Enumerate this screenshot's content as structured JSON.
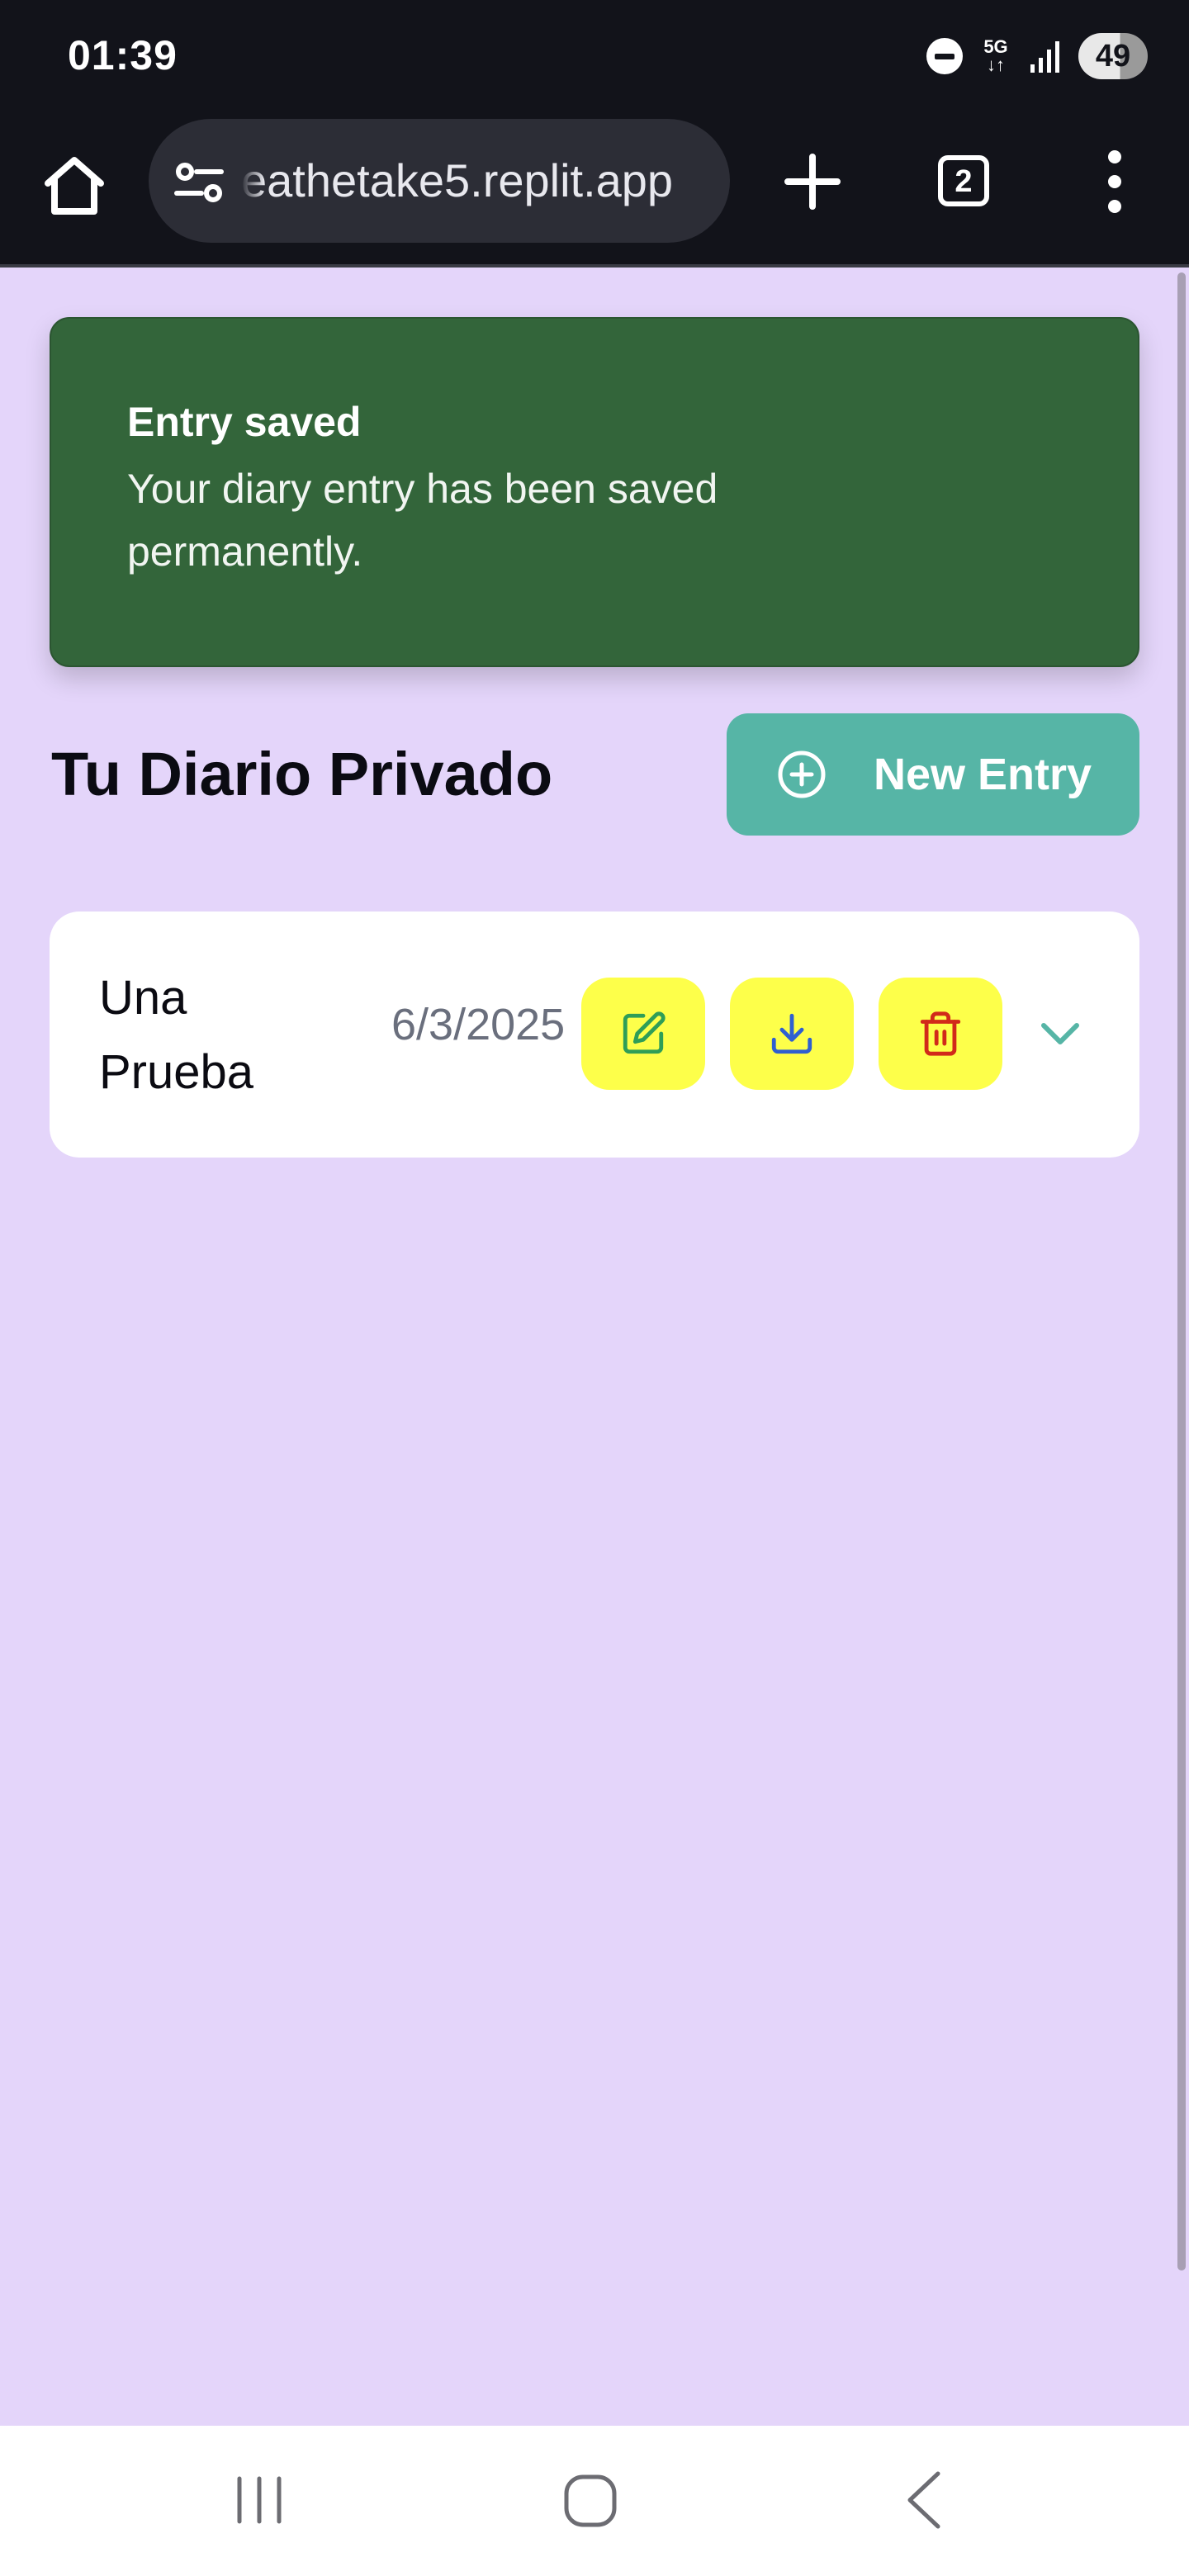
{
  "status_bar": {
    "time": "01:39",
    "network": "5G",
    "battery": "49",
    "icons": [
      "do-not-disturb-icon",
      "network-5g-icon",
      "signal-icon",
      "battery-icon"
    ]
  },
  "browser": {
    "url": "eathetake5.replit.app",
    "tab_count": "2",
    "icons": [
      "home-icon",
      "site-settings-icon",
      "plus-icon",
      "tabs-icon",
      "more-vertical-icon"
    ]
  },
  "toast": {
    "title": "Entry saved",
    "description": "Your diary entry has been saved permanently."
  },
  "header": {
    "title": "Tu Diario Privado",
    "new_entry_label": "New Entry"
  },
  "entries": [
    {
      "title": "Una Prueba",
      "date": "6/3/2025",
      "actions": [
        "edit-icon",
        "download-icon",
        "trash-icon"
      ]
    }
  ],
  "colors": {
    "background": "#e4d5fa",
    "toast": "#33653a",
    "accent": "#56b5a6",
    "action_button": "#fdff4a",
    "edit_icon": "#2f9e57",
    "download_icon": "#2f5fd0",
    "trash_icon": "#d12a1a"
  },
  "nav_bar": {
    "icons": [
      "recent-apps-icon",
      "home-circle-icon",
      "back-icon"
    ]
  }
}
